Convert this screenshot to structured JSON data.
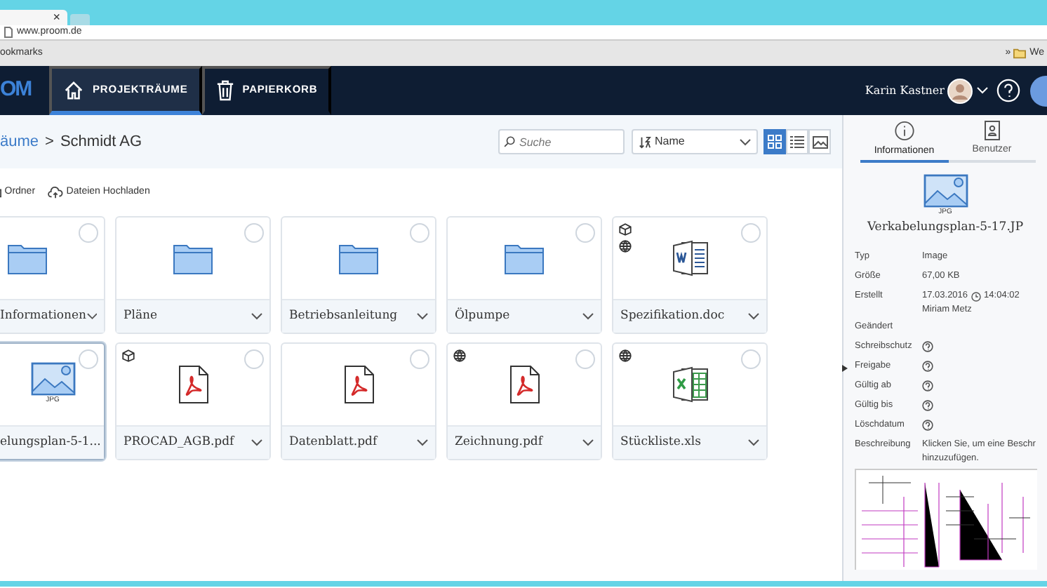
{
  "browser": {
    "tab_close": "×",
    "url": "www.proom.de",
    "bookmarks_label": "ookmarks",
    "bookmarks_overflow": "»",
    "bookmark_folder": "We"
  },
  "navbar": {
    "logo": "OM",
    "items": [
      {
        "label": "PROJEKTRÄUME",
        "selected": true
      },
      {
        "label": "PAPIERKORB",
        "selected": false
      }
    ],
    "user": "Karin Kastner"
  },
  "toolbar": {
    "breadcrumb": [
      "äume",
      "Schmidt AG"
    ],
    "separator": ">",
    "search": {
      "placeholder": "Suche"
    },
    "sort": {
      "value": "Name"
    },
    "views": [
      {
        "selected": true
      },
      {
        "selected": false
      },
      {
        "selected": false
      }
    ]
  },
  "actions": [
    "Ordner",
    "Dateien Hochladen"
  ],
  "files": [
    {
      "name": "Informationen",
      "kind": "folder",
      "selected": false,
      "locked": false,
      "shared": false
    },
    {
      "name": "Pläne",
      "kind": "folder",
      "selected": false,
      "locked": false,
      "shared": false
    },
    {
      "name": "Betriebsanleitung",
      "kind": "folder",
      "selected": false,
      "locked": false,
      "shared": false
    },
    {
      "name": "Ölpumpe",
      "kind": "folder",
      "selected": false,
      "locked": false,
      "shared": false
    },
    {
      "name": "Spezifikation.doc",
      "kind": "word",
      "selected": false,
      "locked": true,
      "shared": true
    },
    {
      "name": "elungsplan-5-1...",
      "kind": "image",
      "type_label": "JPG",
      "selected": true,
      "locked": false,
      "shared": false
    },
    {
      "name": "PROCAD_AGB.pdf",
      "kind": "pdf",
      "selected": false,
      "locked": true,
      "shared": false
    },
    {
      "name": "Datenblatt.pdf",
      "kind": "pdf",
      "selected": false,
      "locked": false,
      "shared": false
    },
    {
      "name": "Zeichnung.pdf",
      "kind": "pdf",
      "selected": false,
      "locked": false,
      "shared": true
    },
    {
      "name": "Stückliste.xls",
      "kind": "excel",
      "selected": false,
      "locked": false,
      "shared": true
    }
  ],
  "details": {
    "tabs": [
      {
        "label": "Informationen",
        "selected": true
      },
      {
        "label": "Benutzer",
        "selected": false
      }
    ],
    "file_type_label": "JPG",
    "file_name": "Verkabelungsplan-5-17.JP",
    "properties": [
      {
        "label": "Typ",
        "kind": "text",
        "value": "Image"
      },
      {
        "label": "Größe",
        "kind": "text",
        "value": "67,00 KB"
      },
      {
        "label": "Erstellt",
        "kind": "created",
        "value": "17.03.2016",
        "time": "14:04:02",
        "author": "Miriam Metz"
      },
      {
        "label": "Geändert",
        "kind": "empty"
      },
      {
        "label": "Schreibschutz",
        "kind": "help"
      },
      {
        "label": "Freigabe",
        "kind": "help"
      },
      {
        "label": "Gültig ab",
        "kind": "help"
      },
      {
        "label": "Gültig bis",
        "kind": "help"
      },
      {
        "label": "Löschdatum",
        "kind": "help"
      },
      {
        "label": "Beschreibung",
        "kind": "text",
        "value": "Klicken Sie, um eine Beschr hinzuzufügen."
      }
    ]
  }
}
